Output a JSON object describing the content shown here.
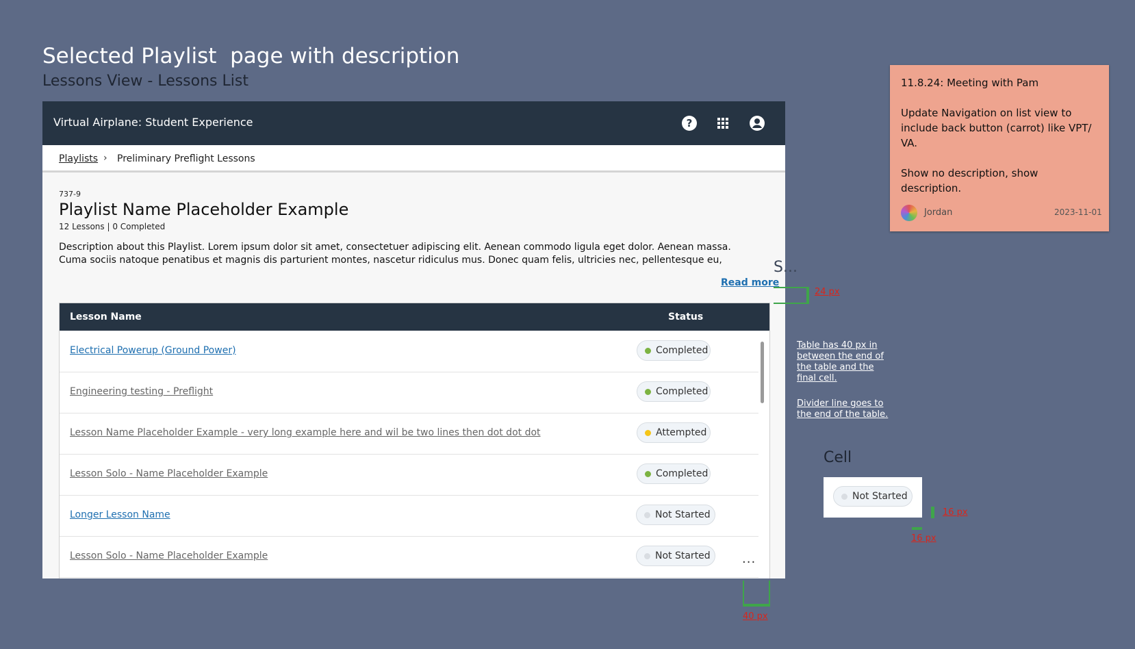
{
  "frame": {
    "title": "Selected Playlist  page with description",
    "subtitle": "Lessons View - Lessons List"
  },
  "app": {
    "title": "Virtual Airplane: Student Experience",
    "icons": [
      "help-icon",
      "apps-grid-icon",
      "account-icon"
    ]
  },
  "breadcrumb": {
    "link": "Playlists",
    "separator": "›",
    "current": "Preliminary Preflight Lessons"
  },
  "playlist": {
    "code": "737-9",
    "name": "Playlist Name Placeholder Example",
    "meta": "12 Lessons | 0 Completed",
    "description": "Description about this Playlist. Lorem ipsum dolor sit amet, consectetuer adipiscing elit. Aenean commodo ligula eget dolor. Aenean massa. Cuma sociis natoque penatibus et magnis dis parturient montes, nascetur ridiculus mus. Donec quam felis, ultricies nec, pellentesque eu,",
    "read_more": "Read more"
  },
  "table": {
    "headers": {
      "name": "Lesson Name",
      "status": "Status"
    },
    "rows": [
      {
        "name": "Electrical Powerup (Ground Power)",
        "status": "Completed"
      },
      {
        "name": "Engineering testing - Preflight",
        "status": "Completed"
      },
      {
        "name": "Lesson Name Placeholder Example - very long example here and wil be two lines then dot dot dot",
        "status": "Attempted"
      },
      {
        "name": "Lesson Solo - Name Placeholder Example",
        "status": "Completed"
      },
      {
        "name": "Longer Lesson Name",
        "status": "Not Started"
      },
      {
        "name": "Lesson Solo - Name Placeholder Example",
        "status": "Not Started"
      }
    ],
    "more": "..."
  },
  "status_colors": {
    "Completed": "#7cb342",
    "Attempted": "#f5c518",
    "Not Started": "#d9dde2"
  },
  "sticky_note": {
    "line1": "11.8.24: Meeting with Pam",
    "line2": "Update Navigation on list view to include back button (carrot) like VPT/ VA.",
    "line3": "Show no description, show description.",
    "author": "Jordan",
    "date": "2023-11-01"
  },
  "annotations": {
    "section_tag": "S...",
    "table_note": "Table has 40 px in between the end of the table and the final cell.",
    "divider_note": "Divider line goes to the end of the table.",
    "cell_title": "Cell",
    "cell_status": "Not Started",
    "m24": "24 px",
    "m16a": "16 px",
    "m16b": "16 px",
    "m40": "40 px"
  }
}
